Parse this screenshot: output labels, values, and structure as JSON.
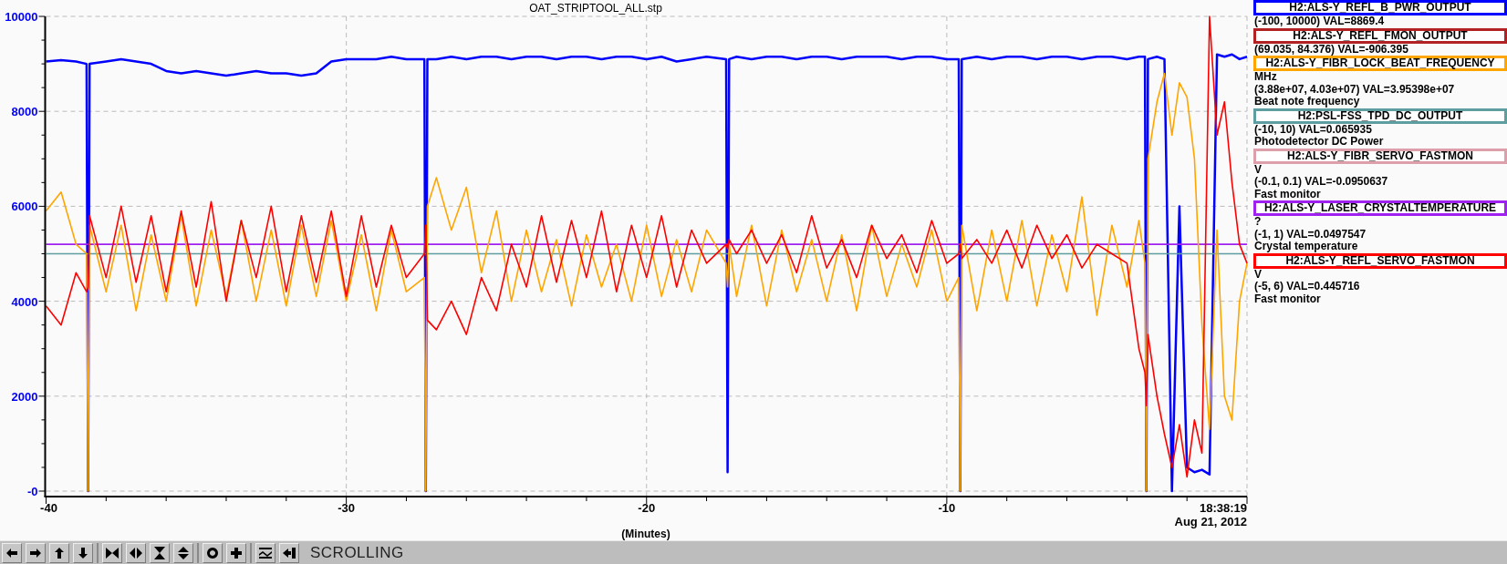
{
  "chart": {
    "chart_data": {
      "type": "line",
      "title": "OAT_STRIPTOOL_ALL.stp",
      "xlabel": "(Minutes)",
      "xlim": [
        -40,
        0
      ],
      "ylim": [
        -115,
        10000
      ],
      "grid": true,
      "xticks": [
        -40,
        -30,
        -20,
        -10
      ],
      "yticks": [
        {
          "value": 0,
          "label": "-0"
        },
        2000,
        4000,
        6000,
        8000,
        10000
      ],
      "x": [
        -40,
        -39.5,
        -39,
        -38.65,
        -38.6,
        -38.55,
        -38,
        -37.5,
        -37,
        -36.5,
        -36,
        -35.5,
        -35,
        -34.5,
        -34,
        -33.5,
        -33,
        -32.5,
        -32,
        -31.5,
        -31,
        -30.5,
        -30,
        -29.5,
        -29,
        -28.5,
        -28,
        -27.4,
        -27.35,
        -27.3,
        -27,
        -26.5,
        -26,
        -25.5,
        -25,
        -24.5,
        -24,
        -23.5,
        -23,
        -22.5,
        -22,
        -21.5,
        -21,
        -20.5,
        -20,
        -19.5,
        -19,
        -18.5,
        -18,
        -17.35,
        -17.3,
        -17.25,
        -17,
        -16.5,
        -16,
        -15.5,
        -15,
        -14.5,
        -14,
        -13.5,
        -13,
        -12.5,
        -12,
        -11.5,
        -11,
        -10.5,
        -10,
        -9.6,
        -9.55,
        -9.5,
        -9,
        -8.5,
        -8,
        -7.5,
        -7,
        -6.5,
        -6,
        -5.5,
        -5,
        -4.5,
        -4,
        -3.6,
        -3.4,
        -3.35,
        -3.3,
        -3,
        -2.75,
        -2.5,
        -2.25,
        -2,
        -1.75,
        -1.5,
        -1.25,
        -1,
        -0.75,
        -0.5,
        -0.25,
        0
      ],
      "series": [
        {
          "color": "#0000ff",
          "values": [
            9050,
            9080,
            9050,
            9000,
            0,
            9000,
            9050,
            9100,
            9050,
            9000,
            8850,
            8800,
            8850,
            8800,
            8750,
            8800,
            8850,
            8800,
            8800,
            8750,
            8800,
            9050,
            9100,
            9100,
            9100,
            9150,
            9100,
            9100,
            0,
            9100,
            9100,
            9150,
            9100,
            9150,
            9150,
            9100,
            9150,
            9150,
            9100,
            9150,
            9150,
            9100,
            9150,
            9150,
            9100,
            9150,
            9050,
            9100,
            9150,
            9100,
            400,
            9100,
            9150,
            9100,
            9150,
            9150,
            9100,
            9150,
            9150,
            9100,
            9150,
            9150,
            9150,
            9100,
            9150,
            9150,
            9100,
            9100,
            0,
            9100,
            9150,
            9100,
            9150,
            9150,
            9100,
            9150,
            9150,
            9100,
            9150,
            9150,
            9100,
            9150,
            9150,
            0,
            9100,
            9150,
            9100,
            0,
            6000,
            500,
            400,
            450,
            350,
            9200,
            9150,
            9200,
            9100,
            9150
          ]
        },
        {
          "color": "#5f9ea0",
          "values": [
            5000,
            5000,
            5000,
            5000,
            5000,
            5000,
            5000,
            5000,
            5000,
            5000,
            5000,
            5000,
            5000,
            5000,
            5000,
            5000,
            5000,
            5000,
            5000,
            5000,
            5000,
            5000,
            5000,
            5000,
            5000,
            5000,
            5000,
            5000,
            5000,
            5000,
            5000,
            5000,
            5000,
            5000,
            5000,
            5000,
            5000,
            5000,
            5000,
            5000,
            5000,
            5000,
            5000,
            5000,
            5000,
            5000,
            5000,
            5000,
            5000,
            5000,
            5000,
            5000,
            5000,
            5000,
            5000,
            5000,
            5000,
            5000,
            5000,
            5000,
            5000,
            5000,
            5000,
            5000,
            5000,
            5000,
            5000,
            5000,
            5000,
            5000,
            5000,
            5000,
            5000,
            5000,
            5000,
            5000,
            5000,
            5000,
            5000,
            5000,
            5000,
            5000,
            5000,
            5000,
            5000,
            5000,
            5000,
            5000,
            5000,
            5000,
            5000,
            5000,
            5000,
            5000,
            5000,
            5000,
            5000,
            5000
          ]
        },
        {
          "color": "#a020f0",
          "values": [
            5200,
            5200,
            5200,
            5200,
            5200,
            5200,
            5200,
            5200,
            5200,
            5200,
            5200,
            5200,
            5200,
            5200,
            5200,
            5200,
            5200,
            5200,
            5200,
            5200,
            5200,
            5200,
            5200,
            5200,
            5200,
            5200,
            5200,
            5200,
            5200,
            5200,
            5200,
            5200,
            5200,
            5200,
            5200,
            5200,
            5200,
            5200,
            5200,
            5200,
            5200,
            5200,
            5200,
            5200,
            5200,
            5200,
            5200,
            5200,
            5200,
            5200,
            5200,
            5200,
            5200,
            5200,
            5200,
            5200,
            5200,
            5200,
            5200,
            5200,
            5200,
            5200,
            5200,
            5200,
            5200,
            5200,
            5200,
            5200,
            5200,
            5200,
            5200,
            5200,
            5200,
            5200,
            5200,
            5200,
            5200,
            5200,
            5200,
            5200,
            5200,
            5200,
            5200,
            5200,
            5200,
            5200,
            5200,
            5200,
            5200,
            5200,
            5200,
            5200,
            5200,
            5200,
            5200,
            5200,
            5200,
            5200
          ]
        },
        {
          "color": "#ffa500",
          "values": [
            5900,
            6300,
            5200,
            5000,
            0,
            5600,
            4200,
            5600,
            3800,
            5400,
            4000,
            5800,
            3900,
            5500,
            4100,
            5700,
            4000,
            5500,
            3900,
            5600,
            4100,
            5700,
            4000,
            5400,
            3800,
            5500,
            4200,
            4500,
            0,
            6000,
            6600,
            5500,
            6400,
            4600,
            5900,
            4000,
            5500,
            4200,
            5300,
            3900,
            5400,
            4300,
            5200,
            4000,
            5600,
            4100,
            5300,
            4200,
            5500,
            4800,
            4300,
            5200,
            4100,
            5600,
            3900,
            5500,
            4200,
            5300,
            4000,
            5400,
            3800,
            5600,
            4100,
            5200,
            4300,
            5500,
            4000,
            4500,
            0,
            5600,
            3800,
            5500,
            4000,
            5700,
            3900,
            5400,
            4200,
            6200,
            3700,
            5600,
            4300,
            5700,
            4800,
            0,
            7000,
            8200,
            8800,
            7500,
            8600,
            8300,
            7000,
            3500,
            1300,
            5500,
            2000,
            1500,
            4000,
            4800
          ]
        },
        {
          "color": "#ff0000",
          "values": [
            3900,
            3500,
            4600,
            4200,
            4300,
            5800,
            4500,
            6000,
            4400,
            5800,
            4200,
            5900,
            4300,
            6100,
            4000,
            5700,
            4500,
            6000,
            4200,
            5800,
            4400,
            5900,
            4100,
            5800,
            4300,
            5600,
            4500,
            5000,
            5600,
            3600,
            3400,
            4000,
            3300,
            4500,
            3800,
            5200,
            4300,
            5800,
            4400,
            5700,
            4500,
            5900,
            4200,
            5600,
            4500,
            5800,
            4300,
            5500,
            4800,
            5200,
            5100,
            5300,
            5000,
            5500,
            4800,
            5400,
            4600,
            5800,
            4700,
            5300,
            4500,
            5600,
            4900,
            5400,
            4600,
            5700,
            4800,
            5000,
            5200,
            4900,
            5300,
            4800,
            5500,
            4700,
            5600,
            4900,
            5400,
            4700,
            5200,
            5000,
            4800,
            3000,
            2500,
            1800,
            3300,
            2000,
            1200,
            500,
            1400,
            300,
            1500,
            800,
            10000,
            7500,
            8200,
            6500,
            5200,
            4800
          ]
        }
      ]
    },
    "timestamp_time": "18:38:19",
    "timestamp_date": "Aug 21, 2012"
  },
  "legend": [
    {
      "name": "H2:ALS-Y_REFL_B_PWR_OUTPUT",
      "color": "#0000ff",
      "range": "(-100, 10000) VAL=8869.4"
    },
    {
      "name": "H2:ALS-Y_REFL_FMON_OUTPUT",
      "color": "#b22222",
      "range": "(69.035, 84.376) VAL=-906.395"
    },
    {
      "name": "H2:ALS-Y_FIBR_LOCK_BEAT_FREQUENCY",
      "color": "#ffa500",
      "units": "MHz",
      "range": "(3.88e+07, 4.03e+07) VAL=3.95398e+07",
      "description": "Beat note frequency"
    },
    {
      "name": "H2:PSL-FSS_TPD_DC_OUTPUT",
      "color": "#5f9ea0",
      "range": "(-10, 10) VAL=0.065935",
      "description": "Photodetector DC Power"
    },
    {
      "name": "H2:ALS-Y_FIBR_SERVO_FASTMON",
      "color": "#dda0aa",
      "units": "V",
      "range": "(-0.1, 0.1) VAL=-0.0950637",
      "description": "Fast monitor"
    },
    {
      "name": "H2:ALS-Y_LASER_CRYSTALTEMPERATURE",
      "color": "#a020f0",
      "units": "?",
      "range": "(-1, 1) VAL=0.0497547",
      "description": "Crystal temperature"
    },
    {
      "name": "H2:ALS-Y_REFL_SERVO_FASTMON",
      "color": "#ff0000",
      "units": "V",
      "range": "(-5, 6) VAL=0.445716",
      "description": "Fast monitor"
    }
  ],
  "status_bar": {
    "mode": "SCROLLING"
  }
}
